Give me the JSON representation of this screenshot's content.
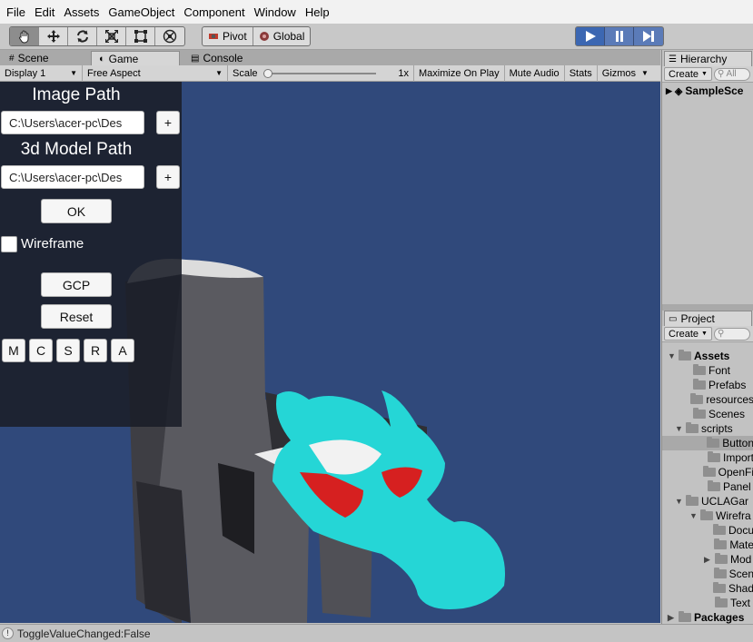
{
  "menubar": [
    "File",
    "Edit",
    "Assets",
    "GameObject",
    "Component",
    "Window",
    "Help"
  ],
  "toolbar": {
    "pivot": "Pivot",
    "global": "Global"
  },
  "tabs": {
    "scene": "Scene",
    "game": "Game",
    "console": "Console"
  },
  "gamebar": {
    "display": "Display 1",
    "aspect": "Free Aspect",
    "scale_label": "Scale",
    "scale_value": "1x",
    "scale_level": 0.0,
    "maximize": "Maximize On Play",
    "mute": "Mute Audio",
    "stats": "Stats",
    "gizmos": "Gizmos"
  },
  "overlay": {
    "image_path_title": "Image Path",
    "image_path_value": "C:\\Users\\acer-pc\\Des",
    "add_label": "+",
    "model_path_title": "3d Model Path",
    "model_path_value": "C:\\Users\\acer-pc\\Des",
    "ok": "OK",
    "wireframe": "Wireframe",
    "wireframe_checked": false,
    "gcp": "GCP",
    "reset": "Reset",
    "mode_buttons": [
      "M",
      "C",
      "S",
      "R",
      "A"
    ]
  },
  "status": {
    "message": "ToggleValueChanged:False"
  },
  "hierarchy": {
    "tab": "Hierarchy",
    "create": "Create",
    "search": "All",
    "scene": "SampleSce"
  },
  "project": {
    "tab": "Project",
    "create": "Create",
    "items": [
      {
        "label": "Assets",
        "arrow": "▼"
      },
      {
        "label": "Font",
        "arrow": ""
      },
      {
        "label": "Prefabs",
        "arrow": ""
      },
      {
        "label": "resources",
        "arrow": ""
      },
      {
        "label": "Scenes",
        "arrow": ""
      },
      {
        "label": "scripts",
        "arrow": "▼"
      },
      {
        "label": "Button",
        "arrow": ""
      },
      {
        "label": "Import",
        "arrow": ""
      },
      {
        "label": "OpenFi",
        "arrow": ""
      },
      {
        "label": "Panel",
        "arrow": ""
      },
      {
        "label": "UCLAGar",
        "arrow": "▼"
      },
      {
        "label": "Wirefra",
        "arrow": "▼"
      },
      {
        "label": "Docu",
        "arrow": ""
      },
      {
        "label": "Mate",
        "arrow": ""
      },
      {
        "label": "Mod",
        "arrow": "▶"
      },
      {
        "label": "Scen",
        "arrow": ""
      },
      {
        "label": "Shad",
        "arrow": ""
      },
      {
        "label": "Text",
        "arrow": ""
      },
      {
        "label": "Packages",
        "arrow": "▶"
      }
    ]
  },
  "colors": {
    "viewport": "#30497b",
    "accent_play": "#3c67b2",
    "model": "#25d6d6"
  }
}
